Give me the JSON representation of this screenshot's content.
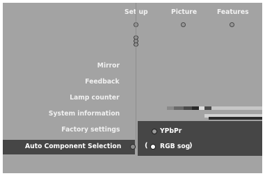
{
  "tabs": [
    {
      "label": "Set up"
    },
    {
      "label": "Picture"
    },
    {
      "label": "Features"
    }
  ],
  "menu": {
    "items": [
      {
        "label": "Mirror"
      },
      {
        "label": "Feedback"
      },
      {
        "label": "Lamp counter"
      },
      {
        "label": "System information"
      },
      {
        "label": "Factory settings"
      }
    ],
    "selected": {
      "label": "Auto Component Selection"
    }
  },
  "submenu": {
    "options": [
      {
        "label": "YPbPr",
        "selected": false
      },
      {
        "label": "RGB sog",
        "selected": true
      }
    ]
  },
  "colors": {
    "background": "#a3a3a3",
    "highlight": "#464646",
    "text": "#f0f0f0"
  }
}
